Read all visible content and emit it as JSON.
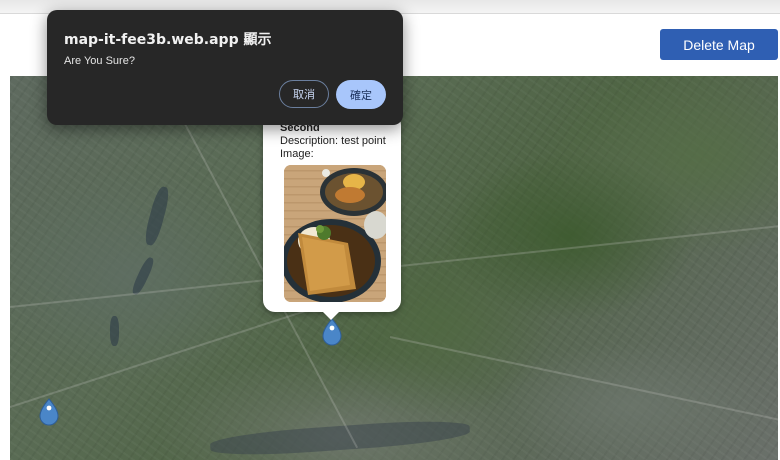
{
  "header": {
    "delete_map_label": "Delete Map"
  },
  "dialog": {
    "title": "map-it-fee3b.web.app 顯示",
    "message": "Are You Sure?",
    "cancel_label": "取消",
    "ok_label": "確定"
  },
  "popup": {
    "title": "Second",
    "description_label": "Description:",
    "description_value": "test point",
    "image_label": "Image:"
  },
  "map": {
    "marker_color": "#4a86c8",
    "markers": [
      "Second",
      "unnamed"
    ]
  },
  "colors": {
    "button_primary": "#2f5fb3",
    "dialog_bg": "#272727",
    "dialog_ok_bg": "#a8c6fb"
  }
}
